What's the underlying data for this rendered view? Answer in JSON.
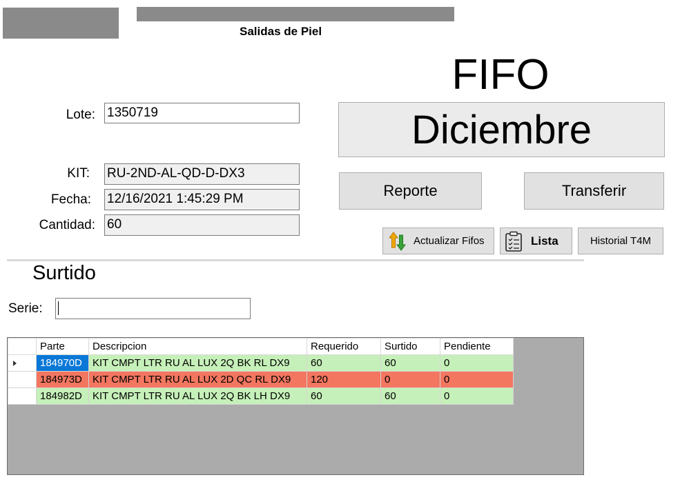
{
  "header": {
    "title": "Salidas de Piel"
  },
  "fifo": {
    "title": "FIFO",
    "month": "Diciembre"
  },
  "form": {
    "lote_label": "Lote:",
    "lote_value": "1350719",
    "kit_label": "KIT:",
    "kit_value": "RU-2ND-AL-QD-D-DX3",
    "fecha_label": "Fecha:",
    "fecha_value": "12/16/2021 1:45:29 PM",
    "cantidad_label": "Cantidad:",
    "cantidad_value": "60"
  },
  "buttons": {
    "reporte": "Reporte",
    "transferir": "Transferir",
    "actualizar": "Actualizar Fifos",
    "lista": "Lista",
    "historial": "Historial T4M"
  },
  "surtido": {
    "title": "Surtido",
    "serie_label": "Serie:",
    "serie_value": ""
  },
  "grid": {
    "columns": [
      "Parte",
      "Descripcion",
      "Requerido",
      "Surtido",
      "Pendiente"
    ],
    "rows": [
      {
        "parte": "184970D",
        "descripcion": "KIT CMPT LTR RU AL LUX 2Q BK RL DX9",
        "requerido": "60",
        "surtido": "60",
        "pendiente": "0",
        "status": "ok",
        "selected": true
      },
      {
        "parte": "184973D",
        "descripcion": "KIT CMPT LTR RU AL LUX 2D QC RL DX9",
        "requerido": "120",
        "surtido": "0",
        "pendiente": "0",
        "status": "bad"
      },
      {
        "parte": "184982D",
        "descripcion": "KIT CMPT LTR RU AL LUX 2Q BK LH DX9",
        "requerido": "60",
        "surtido": "60",
        "pendiente": "0",
        "status": "ok"
      }
    ]
  },
  "colors": {
    "ok_row": "#c6f0b9",
    "bad_row": "#f37660",
    "selected_cell": "#0a78d7",
    "grid_bg": "#ababab"
  }
}
